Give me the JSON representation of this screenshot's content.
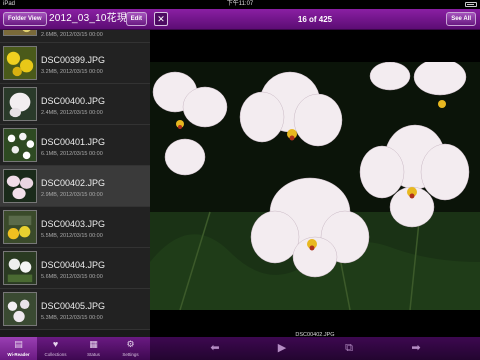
{
  "status": {
    "carrier": "iPad",
    "time": "下午11:07"
  },
  "left_header": {
    "folder_button": "Folder View",
    "title": "2012_03_10花現",
    "edit_button": "Edit"
  },
  "files": [
    {
      "name": "",
      "meta": "2.6MB, 2012/03/15 00:00",
      "partial": true
    },
    {
      "name": "DSC00399.JPG",
      "meta": "3.2MB, 2012/03/15 00:00"
    },
    {
      "name": "DSC00400.JPG",
      "meta": "2.4MB, 2012/03/15 00:00"
    },
    {
      "name": "DSC00401.JPG",
      "meta": "6.1MB, 2012/03/15 00:00"
    },
    {
      "name": "DSC00402.JPG",
      "meta": "2.9MB, 2012/03/15 00:00",
      "selected": true
    },
    {
      "name": "DSC00403.JPG",
      "meta": "5.5MB, 2012/03/15 00:00"
    },
    {
      "name": "DSC00404.JPG",
      "meta": "5.6MB, 2012/03/15 00:00"
    },
    {
      "name": "DSC00405.JPG",
      "meta": "5.3MB, 2012/03/15 00:00"
    }
  ],
  "tabs": [
    {
      "label": "Wi-Reader",
      "icon": "book-icon",
      "active": true
    },
    {
      "label": "Collections",
      "icon": "heart-icon"
    },
    {
      "label": "Status",
      "icon": "status-icon"
    },
    {
      "label": "Settings",
      "icon": "gear-icon"
    }
  ],
  "main_header": {
    "counter": "16 of 425",
    "see_all_button": "See All",
    "fullscreen_icon": "fullscreen-icon"
  },
  "viewer": {
    "caption": "DSC00402.JPG"
  },
  "toolbar_icons": [
    "prev-arrow-icon",
    "play-icon",
    "slideshow-icon",
    "next-arrow-icon"
  ]
}
